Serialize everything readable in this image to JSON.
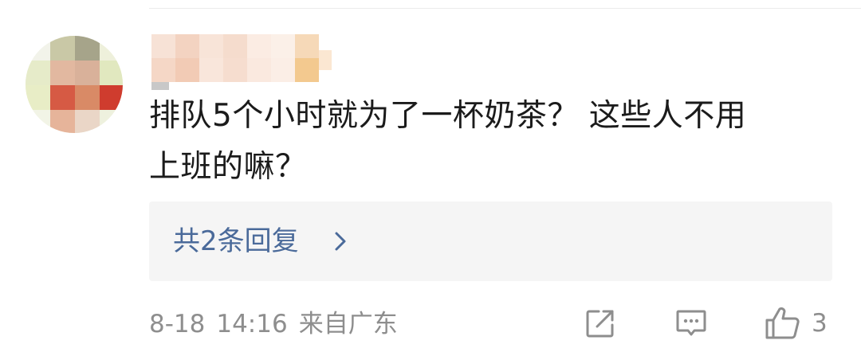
{
  "comment": {
    "text_line1": "排队5个小时就为了一杯奶茶？ 这些人不用",
    "text_line2": "上班的嘛？"
  },
  "replies": {
    "label": "共2条回复"
  },
  "meta": {
    "date": "8-18",
    "time": "14:16",
    "location": "来自广东"
  },
  "actions": {
    "like_count": "3",
    "icons": [
      "share-icon",
      "comment-icon",
      "thumbs-up-icon"
    ]
  },
  "colors": {
    "text": "#1b1b1b",
    "link": "#4a6a9a",
    "muted": "#8e8e8e",
    "reply_bg": "#f5f5f5"
  }
}
